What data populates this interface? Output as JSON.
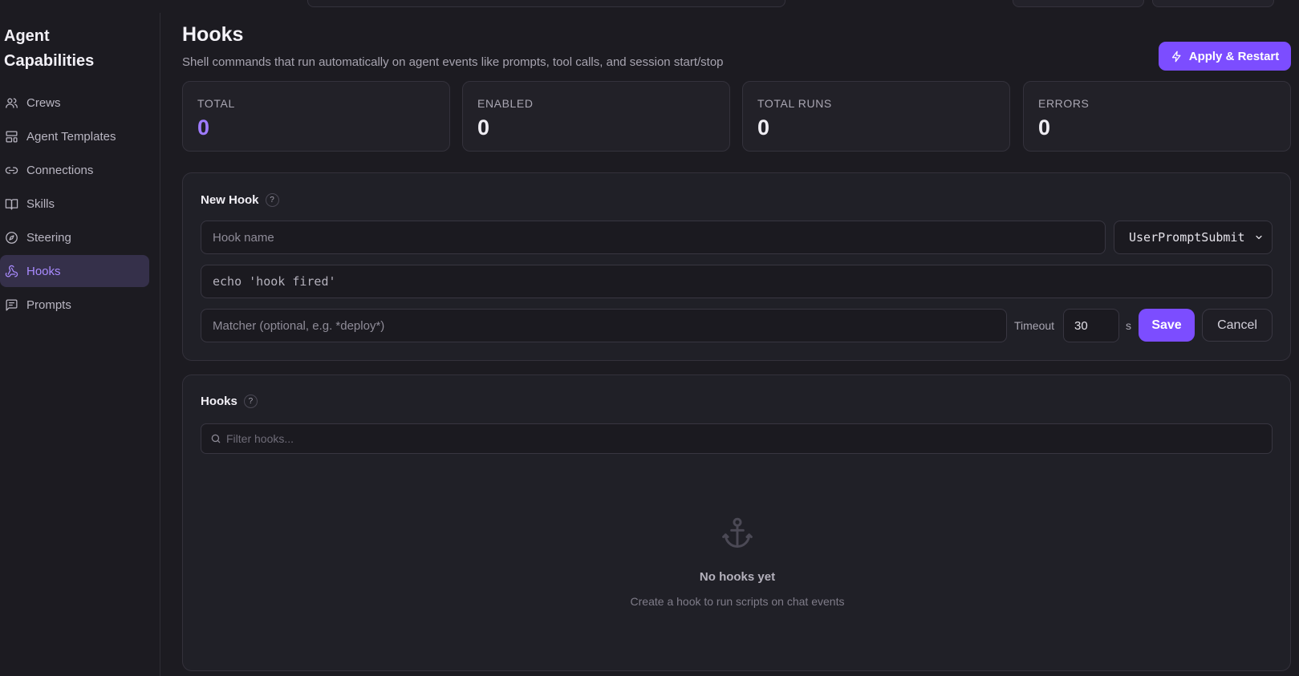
{
  "sidebar": {
    "title": "Agent Capabilities",
    "items": [
      {
        "label": "Crews",
        "icon": "users-icon",
        "active": false
      },
      {
        "label": "Agent Templates",
        "icon": "layout-template-icon",
        "active": false
      },
      {
        "label": "Connections",
        "icon": "link-icon",
        "active": false
      },
      {
        "label": "Skills",
        "icon": "book-icon",
        "active": false
      },
      {
        "label": "Steering",
        "icon": "compass-icon",
        "active": false
      },
      {
        "label": "Hooks",
        "icon": "webhook-icon",
        "active": true
      },
      {
        "label": "Prompts",
        "icon": "message-square-icon",
        "active": false
      }
    ]
  },
  "header": {
    "title": "Hooks",
    "subtitle": "Shell commands that run automatically on agent events like prompts, tool calls, and session start/stop",
    "apply_label": "Apply & Restart"
  },
  "stats": [
    {
      "label": "TOTAL",
      "value": "0"
    },
    {
      "label": "ENABLED",
      "value": "0"
    },
    {
      "label": "TOTAL RUNS",
      "value": "0"
    },
    {
      "label": "ERRORS",
      "value": "0"
    }
  ],
  "new_hook": {
    "title": "New Hook",
    "help": "?",
    "name_placeholder": "Hook name",
    "event_selected": "UserPromptSubmit",
    "command_value": "echo 'hook fired'",
    "matcher_placeholder": "Matcher (optional, e.g. *deploy*)",
    "timeout_label": "Timeout",
    "timeout_value": "30",
    "timeout_unit": "s",
    "save_label": "Save",
    "cancel_label": "Cancel"
  },
  "hooks_list": {
    "title": "Hooks",
    "help": "?",
    "filter_placeholder": "Filter hooks...",
    "empty_title": "No hooks yet",
    "empty_subtitle": "Create a hook to run scripts on chat events"
  },
  "colors": {
    "accent": "#7c4dff",
    "accent_text": "#a98bff",
    "background": "#1c1b21"
  }
}
